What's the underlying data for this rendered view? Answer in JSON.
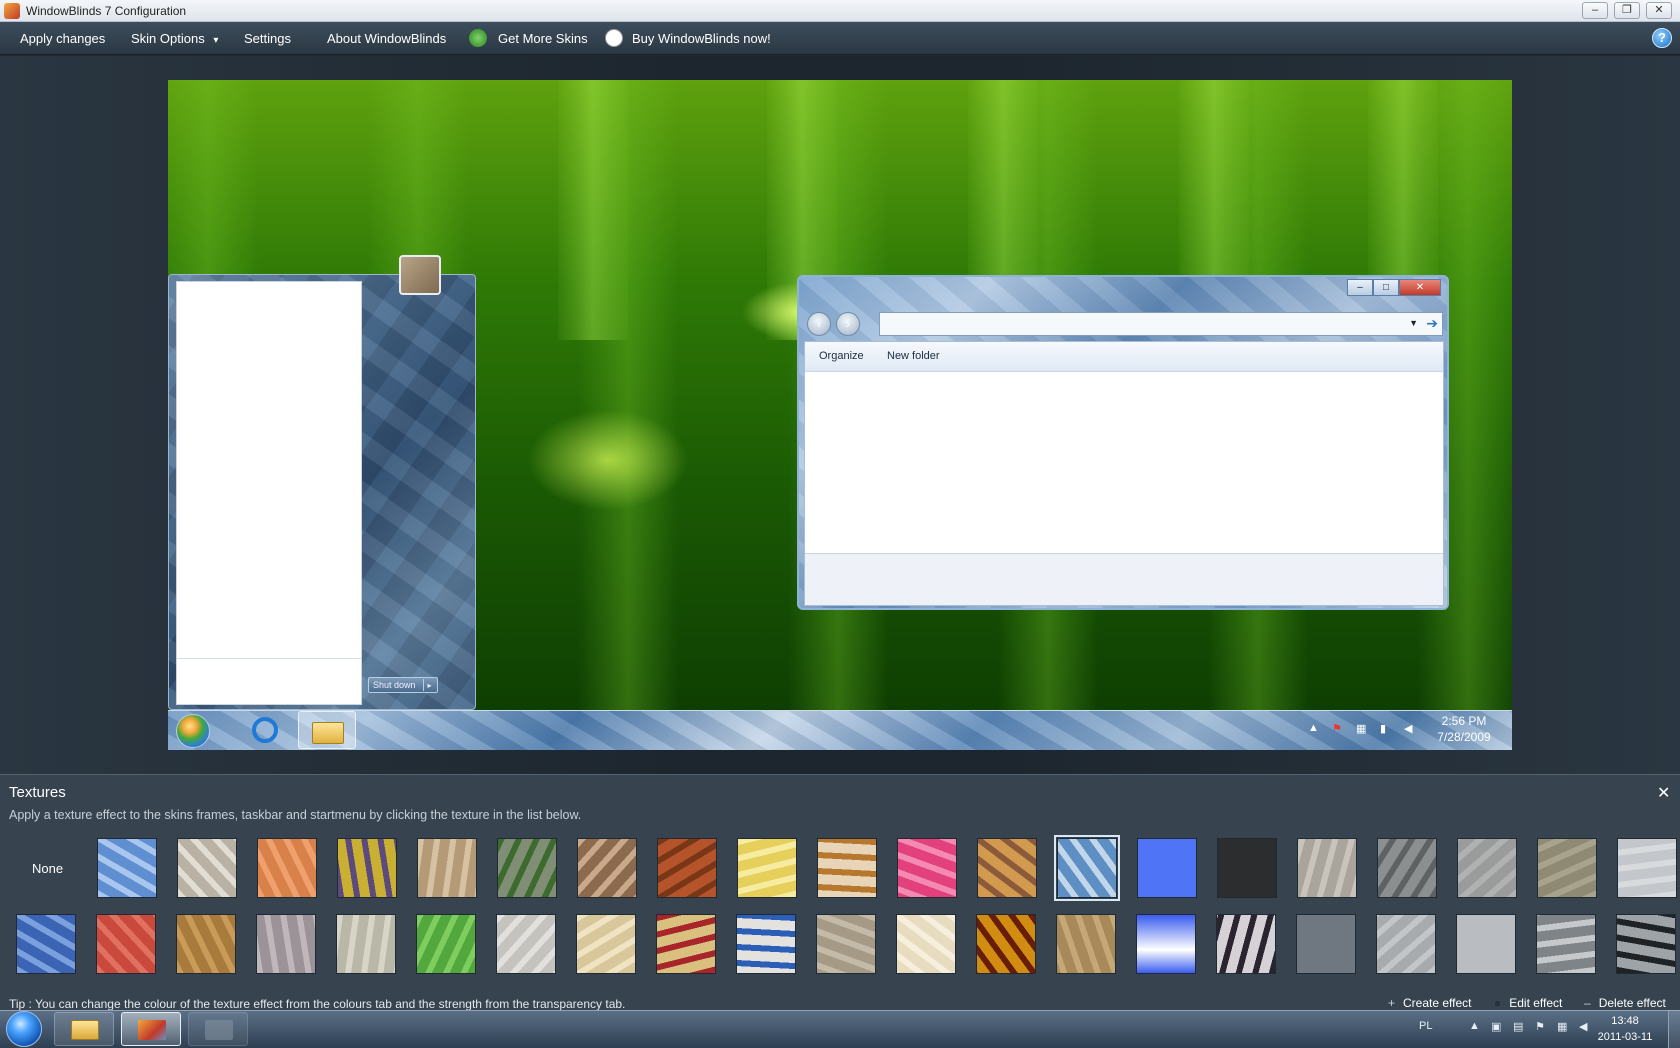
{
  "window": {
    "title": "WindowBlinds 7 Configuration",
    "minimize": "‒",
    "restore": "❐",
    "close": "✕"
  },
  "menu": {
    "apply": "Apply changes",
    "skin_options": "Skin Options",
    "skin_options_arrow": "▾",
    "settings": "Settings",
    "about": "About WindowBlinds",
    "get_more": "Get More Skins",
    "buy": "Buy WindowBlinds now!",
    "help": "?"
  },
  "preview": {
    "shutdown_label": "Shut down",
    "shutdown_arrow": "▸",
    "explorer": {
      "minimize": "‒",
      "maximize": "□",
      "close": "✕",
      "back": "‹",
      "forward": "›",
      "dropdown": "▼",
      "go": "➔",
      "organize": "Organize",
      "new_folder": "New folder"
    },
    "taskbar": {
      "tray_show_hidden": "▲",
      "tray_flag": "⚑",
      "tray_network": "▦",
      "tray_signal": "▮",
      "tray_volume": "◀",
      "time": "2:56 PM",
      "date": "7/28/2009"
    }
  },
  "textures": {
    "title": "Textures",
    "close": "✕",
    "description": "Apply a texture effect to the skins frames, taskbar and startmenu by clicking the texture in the list below.",
    "none_label": "None",
    "row1": [
      {
        "name": "blue-petals",
        "color": "#5f8fd0",
        "accent": "#a9c6ef"
      },
      {
        "name": "silver-pattern",
        "color": "#b9b2a4",
        "accent": "#e2ddd3"
      },
      {
        "name": "orange-sand",
        "color": "#d9814b",
        "accent": "#f0a06c"
      },
      {
        "name": "yellow-lichen",
        "color": "#c9b033",
        "accent": "#5b4a7b"
      },
      {
        "name": "beige-stone",
        "color": "#b59a77",
        "accent": "#d6c2a3"
      },
      {
        "name": "ivy-wall",
        "color": "#7f8e74",
        "accent": "#3d6a2f"
      },
      {
        "name": "cobblestone",
        "color": "#8b6a4e",
        "accent": "#c9a98a"
      },
      {
        "name": "rust",
        "color": "#b5542a",
        "accent": "#7a3717"
      },
      {
        "name": "yellow-tiles",
        "color": "#e6cf5b",
        "accent": "#f6eb9e"
      },
      {
        "name": "leaves-pattern",
        "color": "#e8d5b8",
        "accent": "#b8772f"
      },
      {
        "name": "pink-paint",
        "color": "#e2417e",
        "accent": "#f48ab1"
      },
      {
        "name": "autumn-leaves",
        "color": "#d19a4e",
        "accent": "#8b5a3a"
      },
      {
        "name": "blue-facets",
        "color": "#5e8fc4",
        "accent": "#c2d6ea"
      },
      {
        "name": "solid-blue",
        "color": "#4f74f5",
        "accent": "#5b80ff"
      },
      {
        "name": "solid-dark",
        "color": "#2b2d2f",
        "accent": "#2e3032"
      },
      {
        "name": "cracked-plaster",
        "color": "#aaa59c",
        "accent": "#c9c4bb"
      },
      {
        "name": "grey-smoke",
        "color": "#8c8f90",
        "accent": "#5f6263"
      },
      {
        "name": "grey-concrete",
        "color": "#9a9b9b",
        "accent": "#b0b1b1"
      },
      {
        "name": "khaki-canvas",
        "color": "#8f8a74",
        "accent": "#a8a38d"
      },
      {
        "name": "light-grey",
        "color": "#c3c6ca",
        "accent": "#d8dbde"
      }
    ],
    "row2": [
      {
        "name": "blue-denim-paint",
        "color": "#3b64b4",
        "accent": "#7aa0de"
      },
      {
        "name": "red-wall",
        "color": "#c9493d",
        "accent": "#e0705f"
      },
      {
        "name": "brown-dirt",
        "color": "#a87a3c",
        "accent": "#c99a58"
      },
      {
        "name": "granite",
        "color": "#9c9398",
        "accent": "#c0b7bb"
      },
      {
        "name": "weathered-paper",
        "color": "#b9b7a8",
        "accent": "#d7d5c8"
      },
      {
        "name": "green-leaf",
        "color": "#52a83c",
        "accent": "#7fcd5f"
      },
      {
        "name": "speckled-white",
        "color": "#c5c3be",
        "accent": "#e2e0dc"
      },
      {
        "name": "beige-grid",
        "color": "#d8c79a",
        "accent": "#efe3c2"
      },
      {
        "name": "red-cherries",
        "color": "#d9c07e",
        "accent": "#a8262a"
      },
      {
        "name": "splash-paint",
        "color": "#e4e2de",
        "accent": "#2b5fb7"
      },
      {
        "name": "taupe-wash",
        "color": "#a59a86",
        "accent": "#c4baa8"
      },
      {
        "name": "cream-swirl",
        "color": "#e8dcc0",
        "accent": "#f6efdc"
      },
      {
        "name": "fire",
        "color": "#d08d12",
        "accent": "#6a1d05"
      },
      {
        "name": "tan-leather",
        "color": "#a8895a",
        "accent": "#c6a877"
      },
      {
        "name": "blue-gradient",
        "color": "#3a5cf0",
        "accent": "#ffffff"
      },
      {
        "name": "plaid",
        "color": "#d6d1d6",
        "accent": "#2a2430"
      },
      {
        "name": "slate-grey",
        "color": "#6f7780",
        "accent": "#7b838c"
      },
      {
        "name": "wrinkled-grey",
        "color": "#a7abae",
        "accent": "#c3c6c9"
      },
      {
        "name": "pale-grey",
        "color": "#b9bcc0",
        "accent": "#c9ccd0"
      },
      {
        "name": "scratched-metal",
        "color": "#7e8487",
        "accent": "#c5c9cc"
      },
      {
        "name": "paw-prints",
        "color": "#9ea3a8",
        "accent": "#1f2326"
      }
    ],
    "tip": "Tip : You can change the colour of the texture effect from the colours tab and the strength from the transparency tab.",
    "create_effect": "Create effect",
    "create_icon": "+",
    "edit_effect": "Edit effect",
    "edit_icon": "●",
    "delete_effect": "Delete effect",
    "delete_icon": "–"
  },
  "os_taskbar": {
    "lang": "PL",
    "tray_up": "▲",
    "tray_camera": "▣",
    "tray_keyboard": "▤",
    "tray_flag": "⚑",
    "tray_network": "▦",
    "tray_volume": "◀",
    "time": "13:48",
    "date": "2011-03-11"
  }
}
